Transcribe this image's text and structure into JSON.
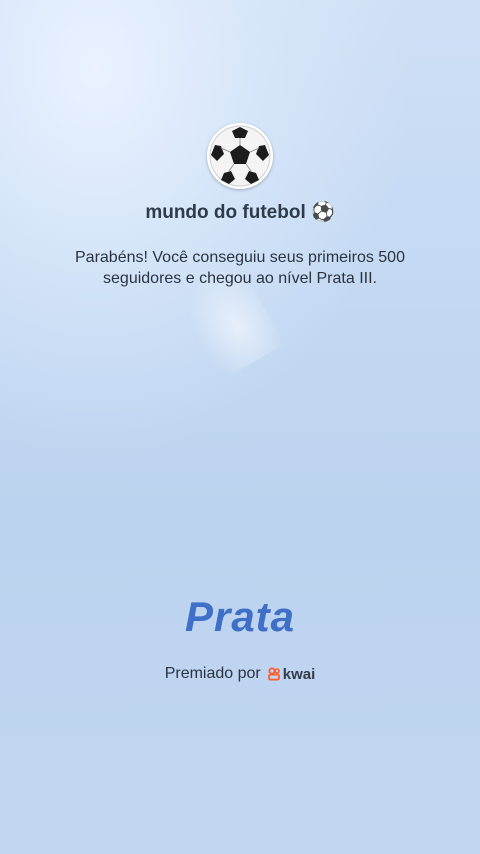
{
  "profile": {
    "name": "mundo do futebol ⚽",
    "avatar_icon": "soccer-ball-icon"
  },
  "message": "Parabéns! Você conseguiu seus primeiros 500 seguidores e chegou ao nível Prata III.",
  "tier": {
    "label": "Prata",
    "color": "#3f6fc6"
  },
  "footer": {
    "awarded_by": "Premiado por",
    "brand": "kwai",
    "brand_icon": "kwai-logo-icon",
    "brand_color": "#ff5a2a"
  }
}
